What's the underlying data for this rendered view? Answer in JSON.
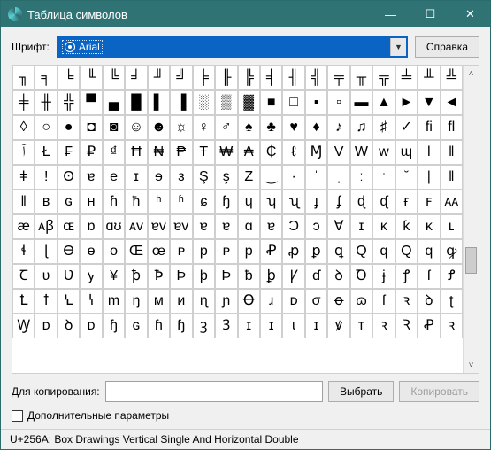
{
  "window": {
    "title": "Таблица символов"
  },
  "toolbar": {
    "font_label": "Шрифт:",
    "font_value": "Arial",
    "help_label": "Справка"
  },
  "grid": {
    "rows": [
      [
        "╖",
        "╕",
        "╘",
        "╙",
        "╚",
        "╛",
        "╜",
        "╝",
        "╞",
        "╟",
        "╠",
        "╡",
        "╢",
        "╣",
        "╤",
        "╥",
        "╦",
        "╧",
        "╨",
        "╩"
      ],
      [
        "╪",
        "╫",
        "╬",
        "▀",
        "▄",
        "█",
        "▌",
        "▐",
        "░",
        "▒",
        "▓",
        "■",
        "□",
        "▪",
        "▫",
        "▬",
        "▲",
        "►",
        "▼",
        "◄"
      ],
      [
        "◊",
        "○",
        "●",
        "◘",
        "◙",
        "☺",
        "☻",
        "☼",
        "♀",
        "♂",
        "♠",
        "♣",
        "♥",
        "♦",
        "♪",
        "♫",
        "♯",
        "✓",
        "ﬁ",
        "ﬂ"
      ],
      [
        "ﭐ",
        "Ł",
        "₣",
        "₽",
        "₫",
        "Ħ",
        "₦",
        "₱",
        "Ŧ",
        "₩",
        "₳",
        "₵",
        "ℓ",
        "Ɱ",
        "V",
        "W",
        "w",
        "ɰ",
        "ǀ",
        "ǁ"
      ],
      [
        "ǂ",
        "ǃ",
        "ʘ",
        "ɐ",
        "e",
        "ɪ",
        "ɘ",
        "ɜ",
        "Ş",
        "ş",
        "Z",
        "‿",
        "·",
        "ˈ",
        "ˌ",
        "ː",
        "ˑ",
        "̆",
        "|",
        "‖"
      ],
      [
        "‖",
        "ʙ",
        "ɢ",
        "ʜ",
        "ɦ",
        "ħ",
        "ʰ",
        "ʱ",
        "ɕ",
        "ɧ",
        "ɥ",
        "ʮ",
        "ʯ",
        "ɟ",
        "ʄ",
        "ɖ",
        "ᶑ",
        "ғ",
        "ꜰ",
        "ᴀᴀ"
      ],
      [
        "æ",
        "ᴀꞵ",
        "ɶ",
        "ɒ",
        "ɑʊ",
        "ᴀᴠ",
        "ɐᴠ",
        "ɐv",
        "ɐ",
        "ɐ",
        "ɑ",
        "ɐ",
        "Ɔ",
        "ᴐ",
        "Ɐ",
        "ɪ",
        "ᴋ",
        "ƙ",
        "ᴋ",
        "ʟ"
      ],
      [
        "ɬ",
        "ɭ",
        "Ɵ",
        "ɵ",
        "ᴏ",
        "Œ",
        "œ",
        "ᴘ",
        "p",
        "ᴘ",
        "p",
        "Ꝓ",
        "ꝓ",
        "ꝑ",
        "ꝗ",
        "Q",
        "q",
        "Q",
        "q",
        "ꝙ"
      ],
      [
        "Ꞇ",
        "ʋ",
        "Ʋ",
        "ꭚ",
        "¥",
        "ꝥ",
        "Ꝥ",
        "Þ",
        "þ",
        "Þ",
        "ƀ",
        "ꝧ",
        "Ꝩ",
        "ɗ",
        "ꝺ",
        "Ꝺ",
        "ɉ",
        "ꝭ",
        "ſ",
        "Ꝭ"
      ],
      [
        "Ꝉ",
        "ꝉ",
        "Ꝇ",
        "ꝇ",
        "m",
        "ŋ",
        "ᴍ",
        "ᴎ",
        "ɳ",
        "ɲ",
        "Ꝋ",
        "ɹ",
        "ᴅ",
        "σ",
        "ꝋ",
        "ɷ",
        "ſ",
        "ꝛ",
        "ꝺ",
        "ʈ"
      ],
      [
        "Ꝡ",
        "ᴅ",
        "ꝺ",
        "ᴅ",
        "ɧ",
        "ɢ",
        "ɦ",
        "ɧ",
        "ꝫ",
        "Ꝫ",
        "ɪ",
        "ɪ",
        "ɩ",
        "ɪ",
        "ꝟ",
        "ᴛ",
        "ꝛ",
        "Ꝛ",
        "Ꝓ",
        "ꝛ"
      ]
    ]
  },
  "copy": {
    "label": "Для копирования:",
    "value": "",
    "select_label": "Выбрать",
    "copy_label": "Копировать"
  },
  "advanced": {
    "label": "Дополнительные параметры"
  },
  "status": {
    "text": "U+256A: Box Drawings Vertical Single And Horizontal Double"
  }
}
